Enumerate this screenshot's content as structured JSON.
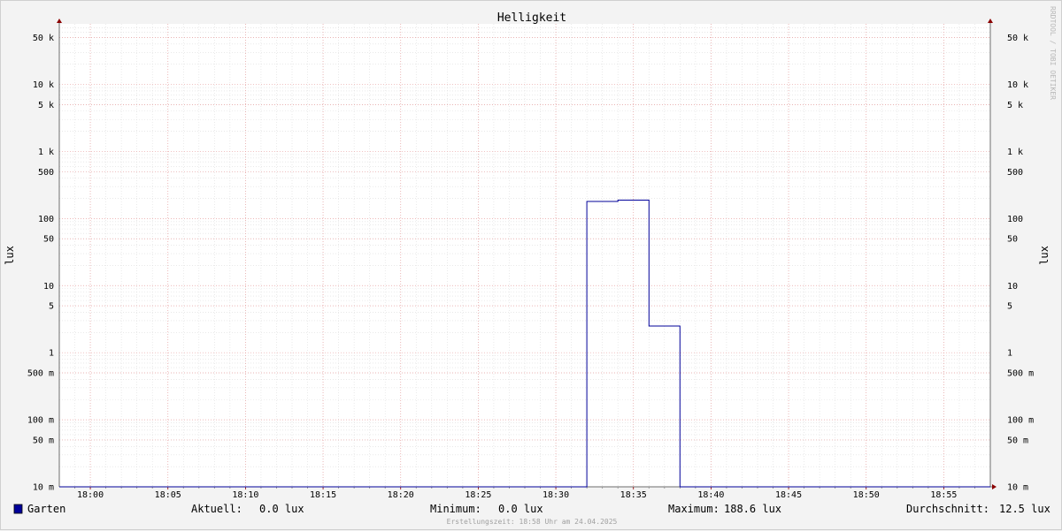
{
  "chart_data": {
    "type": "line",
    "title": "Helligkeit",
    "ylabel": "lux",
    "y_scale": "log",
    "ylim": [
      0.01,
      80000
    ],
    "x_range": [
      "17:58",
      "18:58"
    ],
    "x_ticks": [
      "18:00",
      "18:05",
      "18:10",
      "18:15",
      "18:20",
      "18:25",
      "18:30",
      "18:35",
      "18:40",
      "18:45",
      "18:50",
      "18:55"
    ],
    "y_ticks": [
      {
        "value": 50000,
        "label": "50 k"
      },
      {
        "value": 10000,
        "label": "10 k"
      },
      {
        "value": 5000,
        "label": "5 k"
      },
      {
        "value": 1000,
        "label": "1 k"
      },
      {
        "value": 500,
        "label": "500"
      },
      {
        "value": 100,
        "label": "100"
      },
      {
        "value": 50,
        "label": "50"
      },
      {
        "value": 10,
        "label": "10"
      },
      {
        "value": 5,
        "label": "5"
      },
      {
        "value": 1,
        "label": "1"
      },
      {
        "value": 0.5,
        "label": "500 m"
      },
      {
        "value": 0.1,
        "label": "100 m"
      },
      {
        "value": 0.05,
        "label": "50 m"
      },
      {
        "value": 0.01,
        "label": "10 m"
      }
    ],
    "grid": true,
    "series": [
      {
        "name": "Garten",
        "color": "#00009a",
        "step": true,
        "points": [
          {
            "x": "17:58",
            "y": 0.0
          },
          {
            "x": "18:32",
            "y": 0.0
          },
          {
            "x": "18:32",
            "y": 180
          },
          {
            "x": "18:34",
            "y": 180
          },
          {
            "x": "18:34",
            "y": 188.6
          },
          {
            "x": "18:36",
            "y": 188.6
          },
          {
            "x": "18:36",
            "y": 2.5
          },
          {
            "x": "18:38",
            "y": 2.5
          },
          {
            "x": "18:38",
            "y": 0.0
          },
          {
            "x": "18:58",
            "y": 0.0
          }
        ]
      }
    ],
    "legend": {
      "label": "Garten",
      "placement": "bottom-left",
      "swatch_color": "#00009a",
      "stats": [
        {
          "label": "Aktuell:",
          "value": "0.0 lux"
        },
        {
          "label": "Minimum:",
          "value": "0.0 lux"
        },
        {
          "label": "Maximum:",
          "value": "188.6 lux"
        },
        {
          "label": "Durchschnitt:",
          "value": "12.5 lux"
        }
      ]
    },
    "footer": "Erstellungszeit: 18:58 Uhr am 24.04.2025",
    "watermark": "RRDTOOL / TOBI OETIKER"
  }
}
